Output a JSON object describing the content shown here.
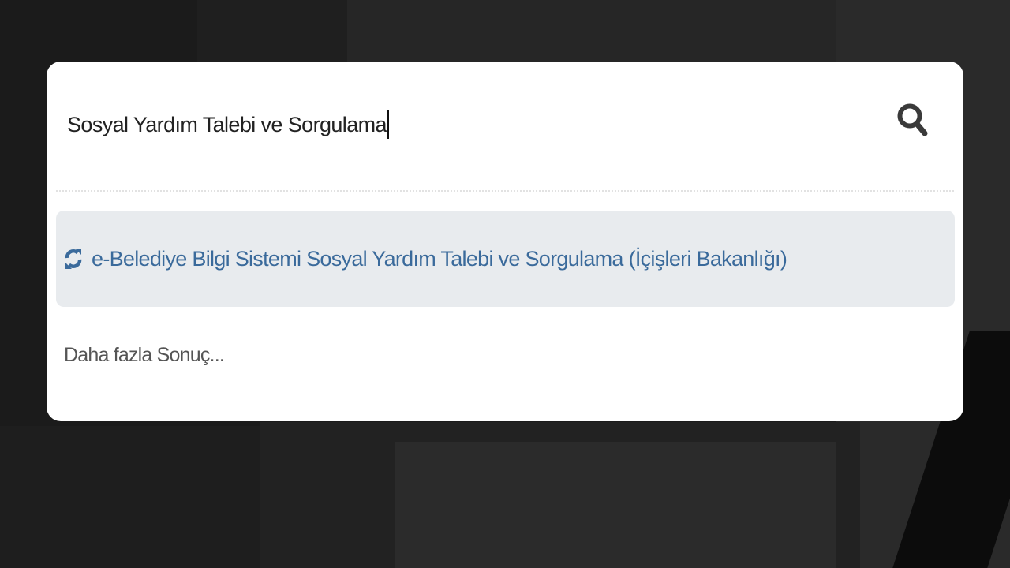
{
  "search": {
    "value": "Sosyal Yardım Talebi ve Sorgulama",
    "button_icon": "search-icon"
  },
  "results": [
    {
      "icon": "refresh-icon",
      "label": "e-Belediye Bilgi Sistemi Sosyal Yardım Talebi ve Sorgulama (İçişleri Bakanlığı)"
    }
  ],
  "more_results_label": "Daha fazla Sonuç...",
  "colors": {
    "panel": "#ffffff",
    "result_highlight": "#e8ebee",
    "result_text": "#3a6a9b",
    "backdrop": "#1b1b1b"
  }
}
